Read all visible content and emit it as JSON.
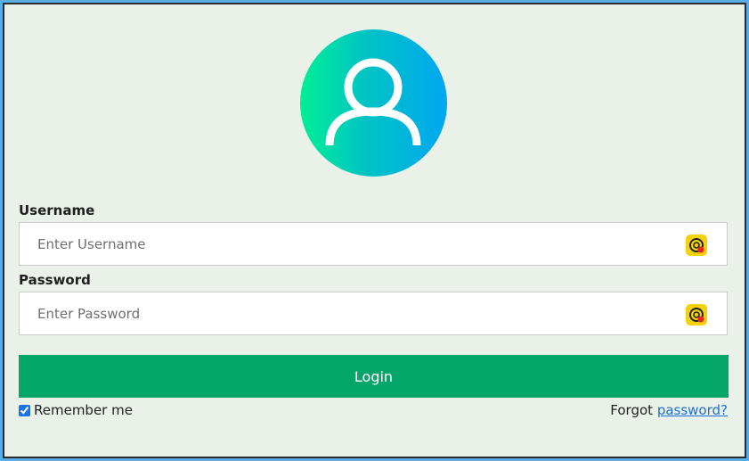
{
  "avatar": {
    "icon": "user-icon"
  },
  "username": {
    "label": "Username",
    "placeholder": "Enter Username",
    "value": ""
  },
  "password": {
    "label": "Password",
    "placeholder": "Enter Password",
    "value": ""
  },
  "login_button": {
    "label": "Login"
  },
  "remember": {
    "label": "Remember me",
    "checked": true
  },
  "forgot": {
    "prefix": "Forgot",
    "link": "password?"
  },
  "colors": {
    "button": "#04a66a",
    "panel_bg": "#e9f1e9",
    "outer_bg": "#5aaee6",
    "link": "#1b6fd6",
    "ext_icon": "#f4d20a"
  }
}
